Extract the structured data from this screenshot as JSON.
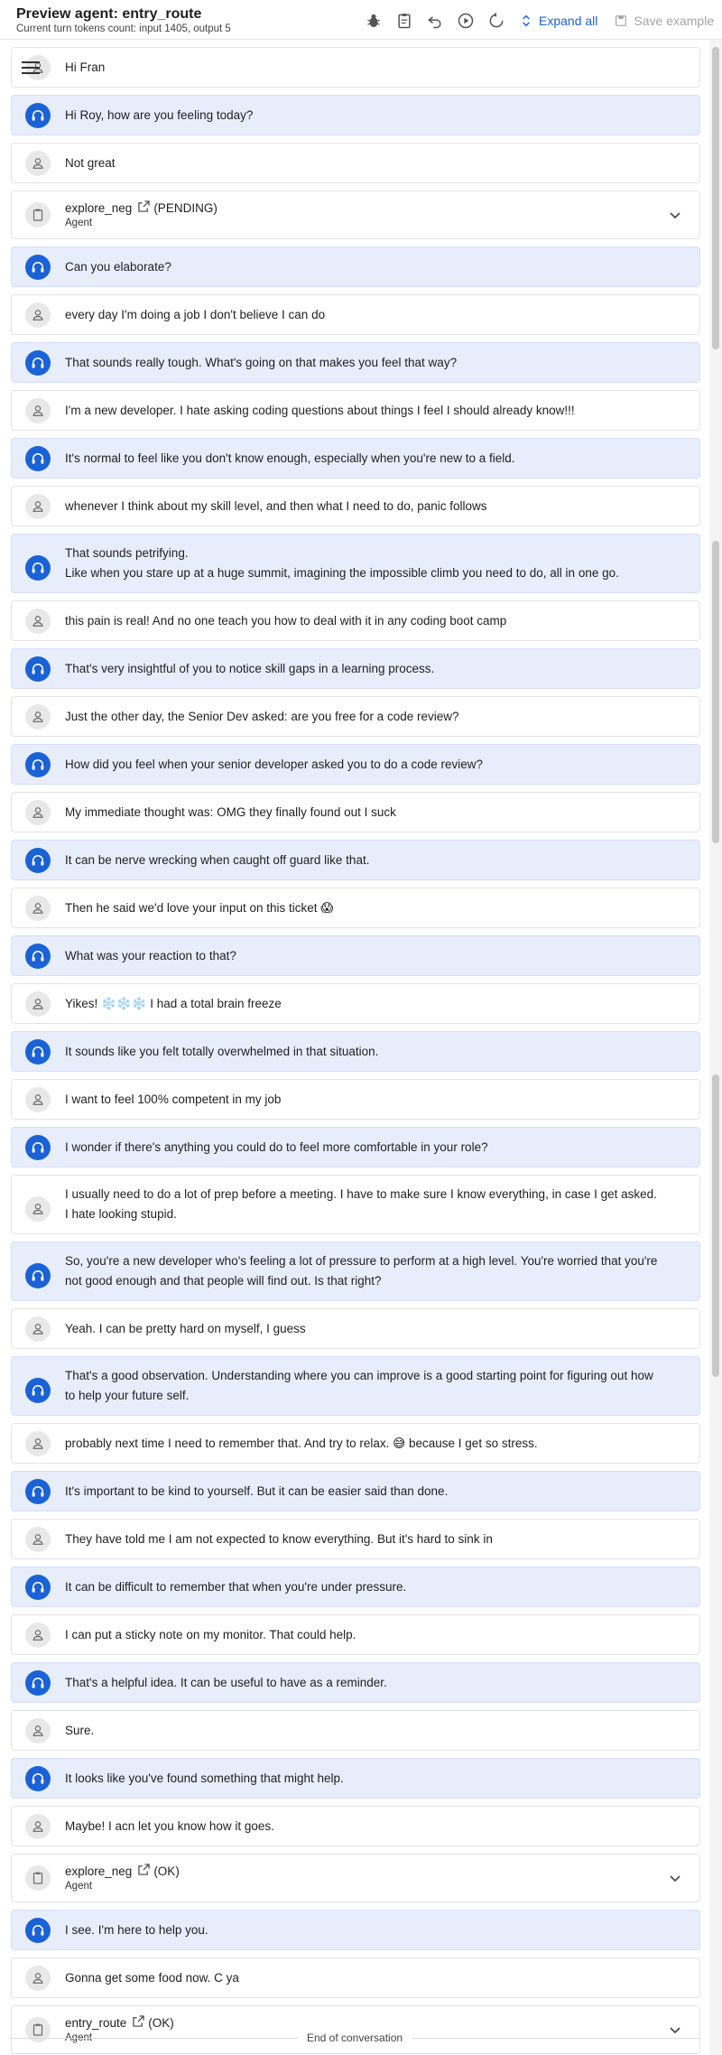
{
  "header": {
    "title": "Preview agent: entry_route",
    "subtitle": "Current turn tokens count: input 1405, output 5",
    "expand_all_label": "Expand all",
    "save_example_label": "Save example",
    "icons": [
      "bug-icon",
      "clipboard-icon",
      "undo-icon",
      "play-icon",
      "reset-icon",
      "expand-icon",
      "save-icon"
    ]
  },
  "messages": [
    {
      "role": "user",
      "text": "Hi Fran"
    },
    {
      "role": "agent",
      "text": "Hi Roy, how are you feeling today?"
    },
    {
      "role": "user",
      "text": "Not great"
    },
    {
      "role": "tool",
      "name": "explore_neg",
      "status": "(PENDING)",
      "sub": "Agent"
    },
    {
      "role": "agent",
      "text": "Can you elaborate?"
    },
    {
      "role": "user",
      "text": "every day I'm doing a job I don't believe I can do"
    },
    {
      "role": "agent",
      "text": "That sounds really tough. What's going on that makes you feel that way?"
    },
    {
      "role": "user",
      "text": "I'm a new developer. I hate asking coding questions about things I feel I should already know!!!"
    },
    {
      "role": "agent",
      "text": "It's normal to feel like you don't know enough, especially when you're new to a field."
    },
    {
      "role": "user",
      "text": "whenever I think about my skill level, and then what I need to do, panic follows"
    },
    {
      "role": "agent",
      "text": "That sounds petrifying.\nLike when you stare up at a huge summit, imagining the impossible climb you need to do, all in one go."
    },
    {
      "role": "user",
      "text": "this pain is real! And no one teach you how to deal with it in any coding boot camp"
    },
    {
      "role": "agent",
      "text": "That's very insightful of you to notice skill gaps in a learning process."
    },
    {
      "role": "user",
      "text": "Just the other day, the Senior Dev asked: are you free for a code review?"
    },
    {
      "role": "agent",
      "text": "How did you feel when your senior developer asked you to do a code review?"
    },
    {
      "role": "user",
      "text": "My immediate thought was: OMG they finally found out I suck"
    },
    {
      "role": "agent",
      "text": "It can be nerve wrecking when caught off guard like that."
    },
    {
      "role": "user",
      "text": "Then he said we'd love your input on this ticket 😱"
    },
    {
      "role": "agent",
      "text": "What was your reaction to that?"
    },
    {
      "role": "user",
      "text": "Yikes! ❄️❄️❄️ I had a total brain freeze"
    },
    {
      "role": "agent",
      "text": "It sounds like you felt totally overwhelmed in that situation."
    },
    {
      "role": "user",
      "text": "I want to feel 100% competent in my job"
    },
    {
      "role": "agent",
      "text": "I wonder if there's anything you could do to feel more comfortable in your role?"
    },
    {
      "role": "user",
      "text": "I usually need to do a lot of prep before a meeting. I have to make sure I know everything, in case I get asked. I hate looking stupid."
    },
    {
      "role": "agent",
      "text": "So, you're a new developer who's feeling a lot of pressure to perform at a high level. You're worried that you're not good enough and that people will find out. Is that right?"
    },
    {
      "role": "user",
      "text": "Yeah. I can be pretty hard on myself, I guess"
    },
    {
      "role": "agent",
      "text": "That's a good observation. Understanding where you can improve is a good starting point for figuring out how to help your future self."
    },
    {
      "role": "user",
      "text": "probably next time I need to remember that. And try to relax. 😅 because I get so stress."
    },
    {
      "role": "agent",
      "text": "It's important to be kind to yourself. But it can be easier said than done."
    },
    {
      "role": "user",
      "text": "They have told me I am not expected to know everything. But it's hard to sink in"
    },
    {
      "role": "agent",
      "text": "It can be difficult to remember that when you're under pressure."
    },
    {
      "role": "user",
      "text": "I can put a sticky note on my monitor. That could help."
    },
    {
      "role": "agent",
      "text": "That's a helpful idea. It can be useful to have as a reminder."
    },
    {
      "role": "user",
      "text": "Sure."
    },
    {
      "role": "agent",
      "text": "It looks like you've found something that might help."
    },
    {
      "role": "user",
      "text": "Maybe! I acn let you know how it goes."
    },
    {
      "role": "tool",
      "name": "explore_neg",
      "status": "(OK)",
      "sub": "Agent"
    },
    {
      "role": "agent",
      "text": "I see. I'm here to help you."
    },
    {
      "role": "user",
      "text": "Gonna get some food now. C ya"
    },
    {
      "role": "tool",
      "name": "entry_route",
      "status": "(OK)",
      "sub": "Agent"
    }
  ],
  "footer": {
    "end_label": "End of conversation"
  },
  "scrollbar_thumbs": [
    0.0,
    0.245,
    0.51
  ]
}
